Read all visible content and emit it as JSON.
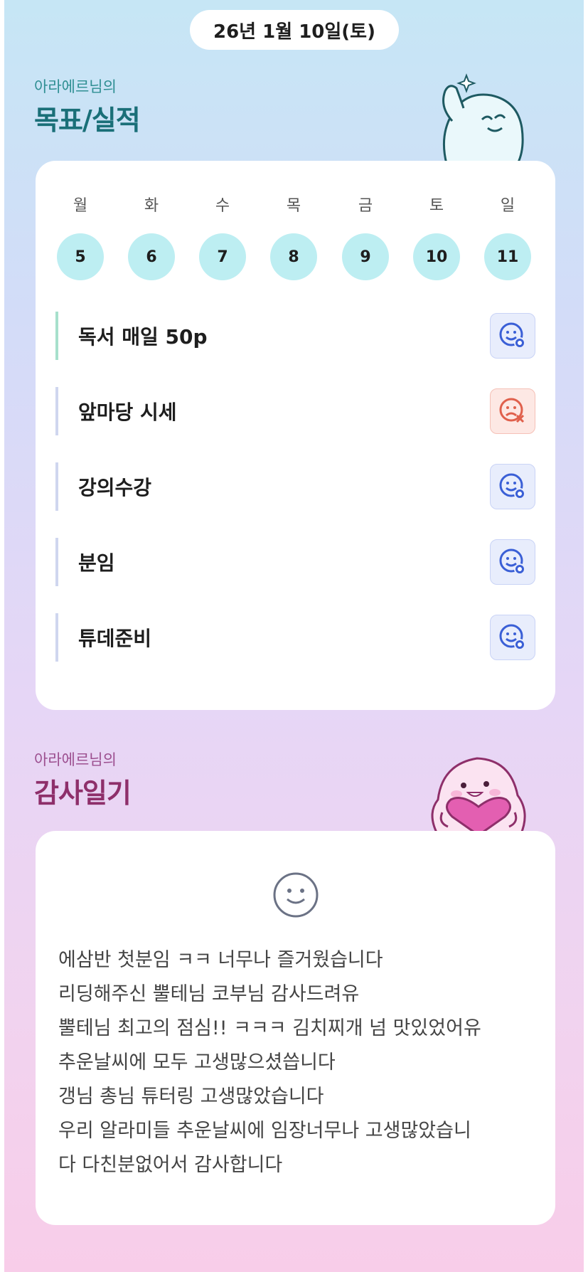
{
  "header": {
    "date": "26년 1월 10일(토)"
  },
  "goals_section": {
    "subtitle": "아라에르님의",
    "title": "목표/실적",
    "week": [
      {
        "day": "월",
        "date": "5"
      },
      {
        "day": "화",
        "date": "6"
      },
      {
        "day": "수",
        "date": "7"
      },
      {
        "day": "목",
        "date": "8"
      },
      {
        "day": "금",
        "date": "9"
      },
      {
        "day": "토",
        "date": "10"
      },
      {
        "day": "일",
        "date": "11"
      }
    ],
    "goals": [
      {
        "label": "독서 매일 50p",
        "status": "achieved",
        "icon": "smile-check-icon"
      },
      {
        "label": "앞마당 시세",
        "status": "missed",
        "icon": "frown-x-icon"
      },
      {
        "label": "강의수강",
        "status": "achieved",
        "icon": "smile-check-icon"
      },
      {
        "label": "분임",
        "status": "achieved",
        "icon": "smile-check-icon"
      },
      {
        "label": "튜데준비",
        "status": "achieved",
        "icon": "smile-check-icon"
      }
    ]
  },
  "diary_section": {
    "subtitle": "아라에르님의",
    "title": "감사일기",
    "icon": "smile-icon",
    "lines": [
      "에삼반 첫분임 ㅋㅋ 너무나 즐거웠습니다",
      "리딩해주신 뿔테님 코부님 감사드려유",
      "뿔테님 최고의 점심!! ㅋㅋㅋ 김치찌개 넘 맛있었어유",
      "추운날씨에 모두 고생많으셨씁니다",
      "갱님 총님 튜터링 고생많았습니다",
      "우리 알라미들 추운날씨에 임장너무나 고생많았습니",
      "다 다친분없어서 감사합니다"
    ]
  },
  "colors": {
    "accent_teal": "#1a6f78",
    "accent_plum": "#8e2f6a",
    "day_circle": "#bdeef2",
    "status_ok": "#3a5fd6",
    "status_fail": "#e0604c"
  }
}
